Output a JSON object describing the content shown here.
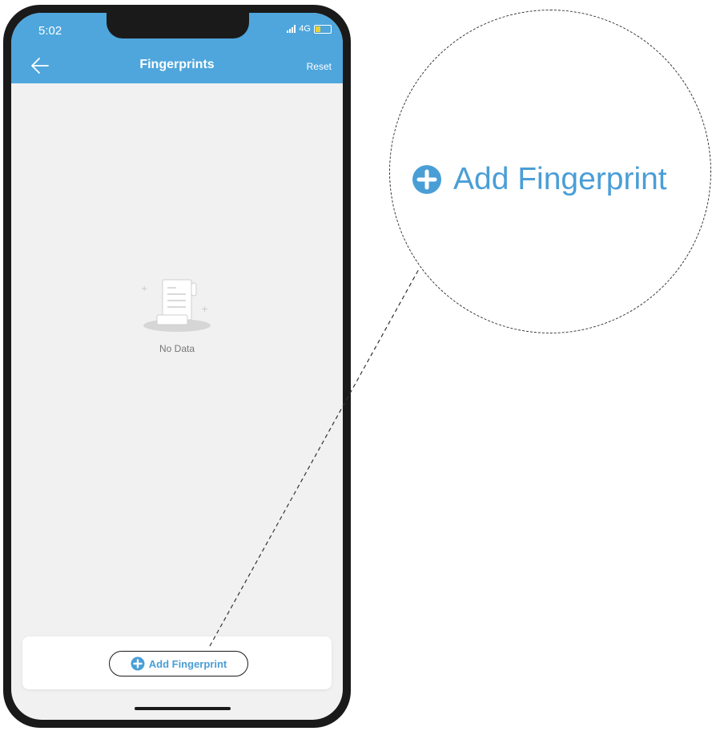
{
  "status_bar": {
    "time": "5:02",
    "network": "4G"
  },
  "header": {
    "title": "Fingerprints",
    "reset_label": "Reset",
    "back_icon": "back-arrow-icon"
  },
  "empty_state": {
    "icon": "document-icon",
    "label": "No Data"
  },
  "footer": {
    "add_label": "Add Fingerprint",
    "add_icon": "plus-circle-icon"
  },
  "callout": {
    "label": "Add Fingerprint",
    "icon": "plus-circle-icon"
  },
  "colors": {
    "app_bar": "#4ea6dc",
    "accent": "#4a9ed6",
    "background": "#f1f1f1"
  }
}
